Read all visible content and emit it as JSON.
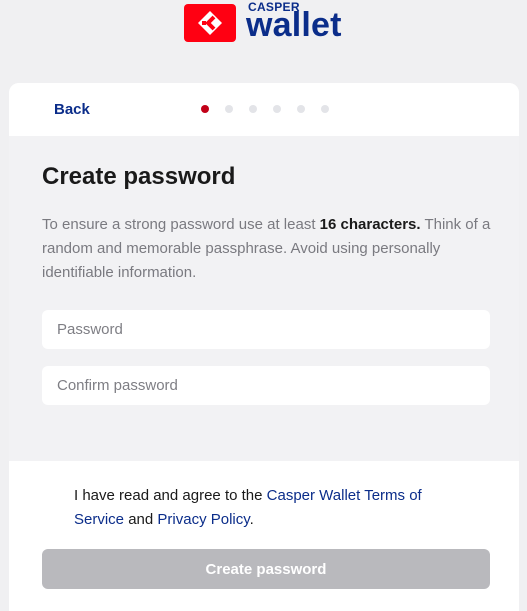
{
  "brand": {
    "small_text": "CASPER",
    "big_text": "wallet",
    "accent_color": "#ff0012",
    "text_color": "#0b2d8a",
    "mark_icon": "casper-logo-icon"
  },
  "header": {
    "back_label": "Back",
    "steps_total": 6,
    "active_step": 1
  },
  "main": {
    "title": "Create password",
    "description_part1": "To ensure a strong password use at least ",
    "description_bold": "16 characters.",
    "description_part2": " Think of a random and memorable passphrase. Avoid using personally identifiable information.",
    "password_placeholder": "Password",
    "password_value": "",
    "confirm_placeholder": "Confirm password",
    "confirm_value": ""
  },
  "footer": {
    "terms_part1": "I have read and agree to the ",
    "terms_link": "Casper Wallet Terms of Service",
    "terms_part2": " and ",
    "privacy_link": "Privacy Policy",
    "terms_part3": ".",
    "submit_label": "Create password",
    "submit_disabled": true
  }
}
